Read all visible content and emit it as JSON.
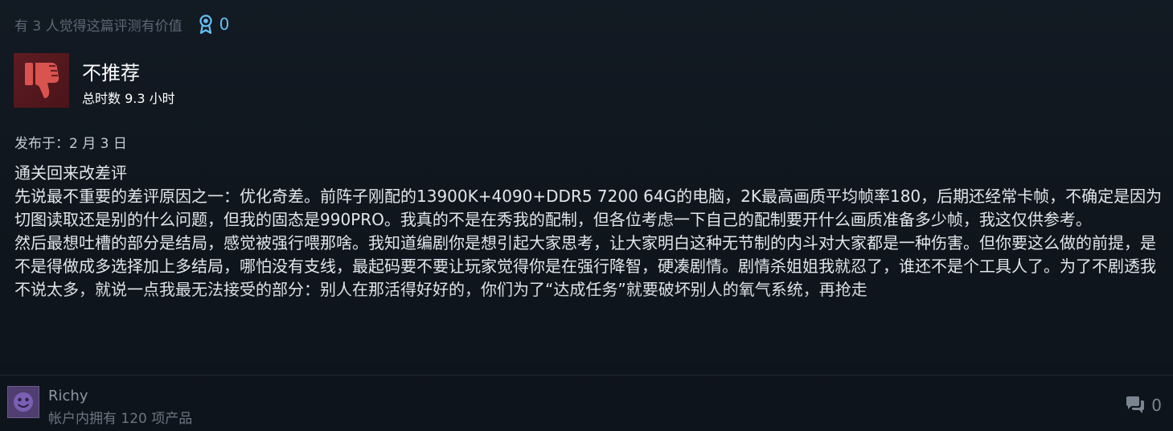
{
  "review": {
    "helpful_text": "有 3 人觉得这篇评测有价值",
    "award_count": "0",
    "verdict": "不推荐",
    "hours": "总时数 9.3 小时",
    "posted": "发布于：2 月 3 日",
    "paragraphs": [
      "通关回来改差评",
      "先说最不重要的差评原因之一：优化奇差。前阵子刚配的13900K+4090+DDR5 7200 64G的电脑，2K最高画质平均帧率180，后期还经常卡帧，不确定是因为切图读取还是别的什么问题，但我的固态是990PRO。我真的不是在秀我的配制，但各位考虑一下自己的配制要开什么画质准备多少帧，我这仅供参考。",
      "然后最想吐槽的部分是结局，感觉被强行喂那啥。我知道编剧你是想引起大家思考，让大家明白这种无节制的内斗对大家都是一种伤害。但你要这么做的前提，是不是得做成多选择加上多结局，哪怕没有支线，最起码要不要让玩家觉得你是在强行降智，硬凑剧情。剧情杀姐姐我就忍了，谁还不是个工具人了。为了不剧透我不说太多，就说一点我最无法接受的部分：别人在那活得好好的，你们为了“达成任务”就要破坏别人的氧气系统，再抢走"
    ]
  },
  "author": {
    "name": "Richy",
    "products": "帐户内拥有 120 项产品"
  },
  "comments": {
    "count": "0"
  },
  "icons": {
    "thumb": "thumbs-down-icon",
    "award": "award-ribbon-icon",
    "comment": "comment-bubbles-icon",
    "avatar": "smiley-avatar"
  },
  "colors": {
    "background": "#0f141b",
    "thumb_box": "#5d1c22",
    "thumb_icon": "#d9534f",
    "award_blue": "#66c0f4",
    "muted_text": "#5b6775"
  }
}
